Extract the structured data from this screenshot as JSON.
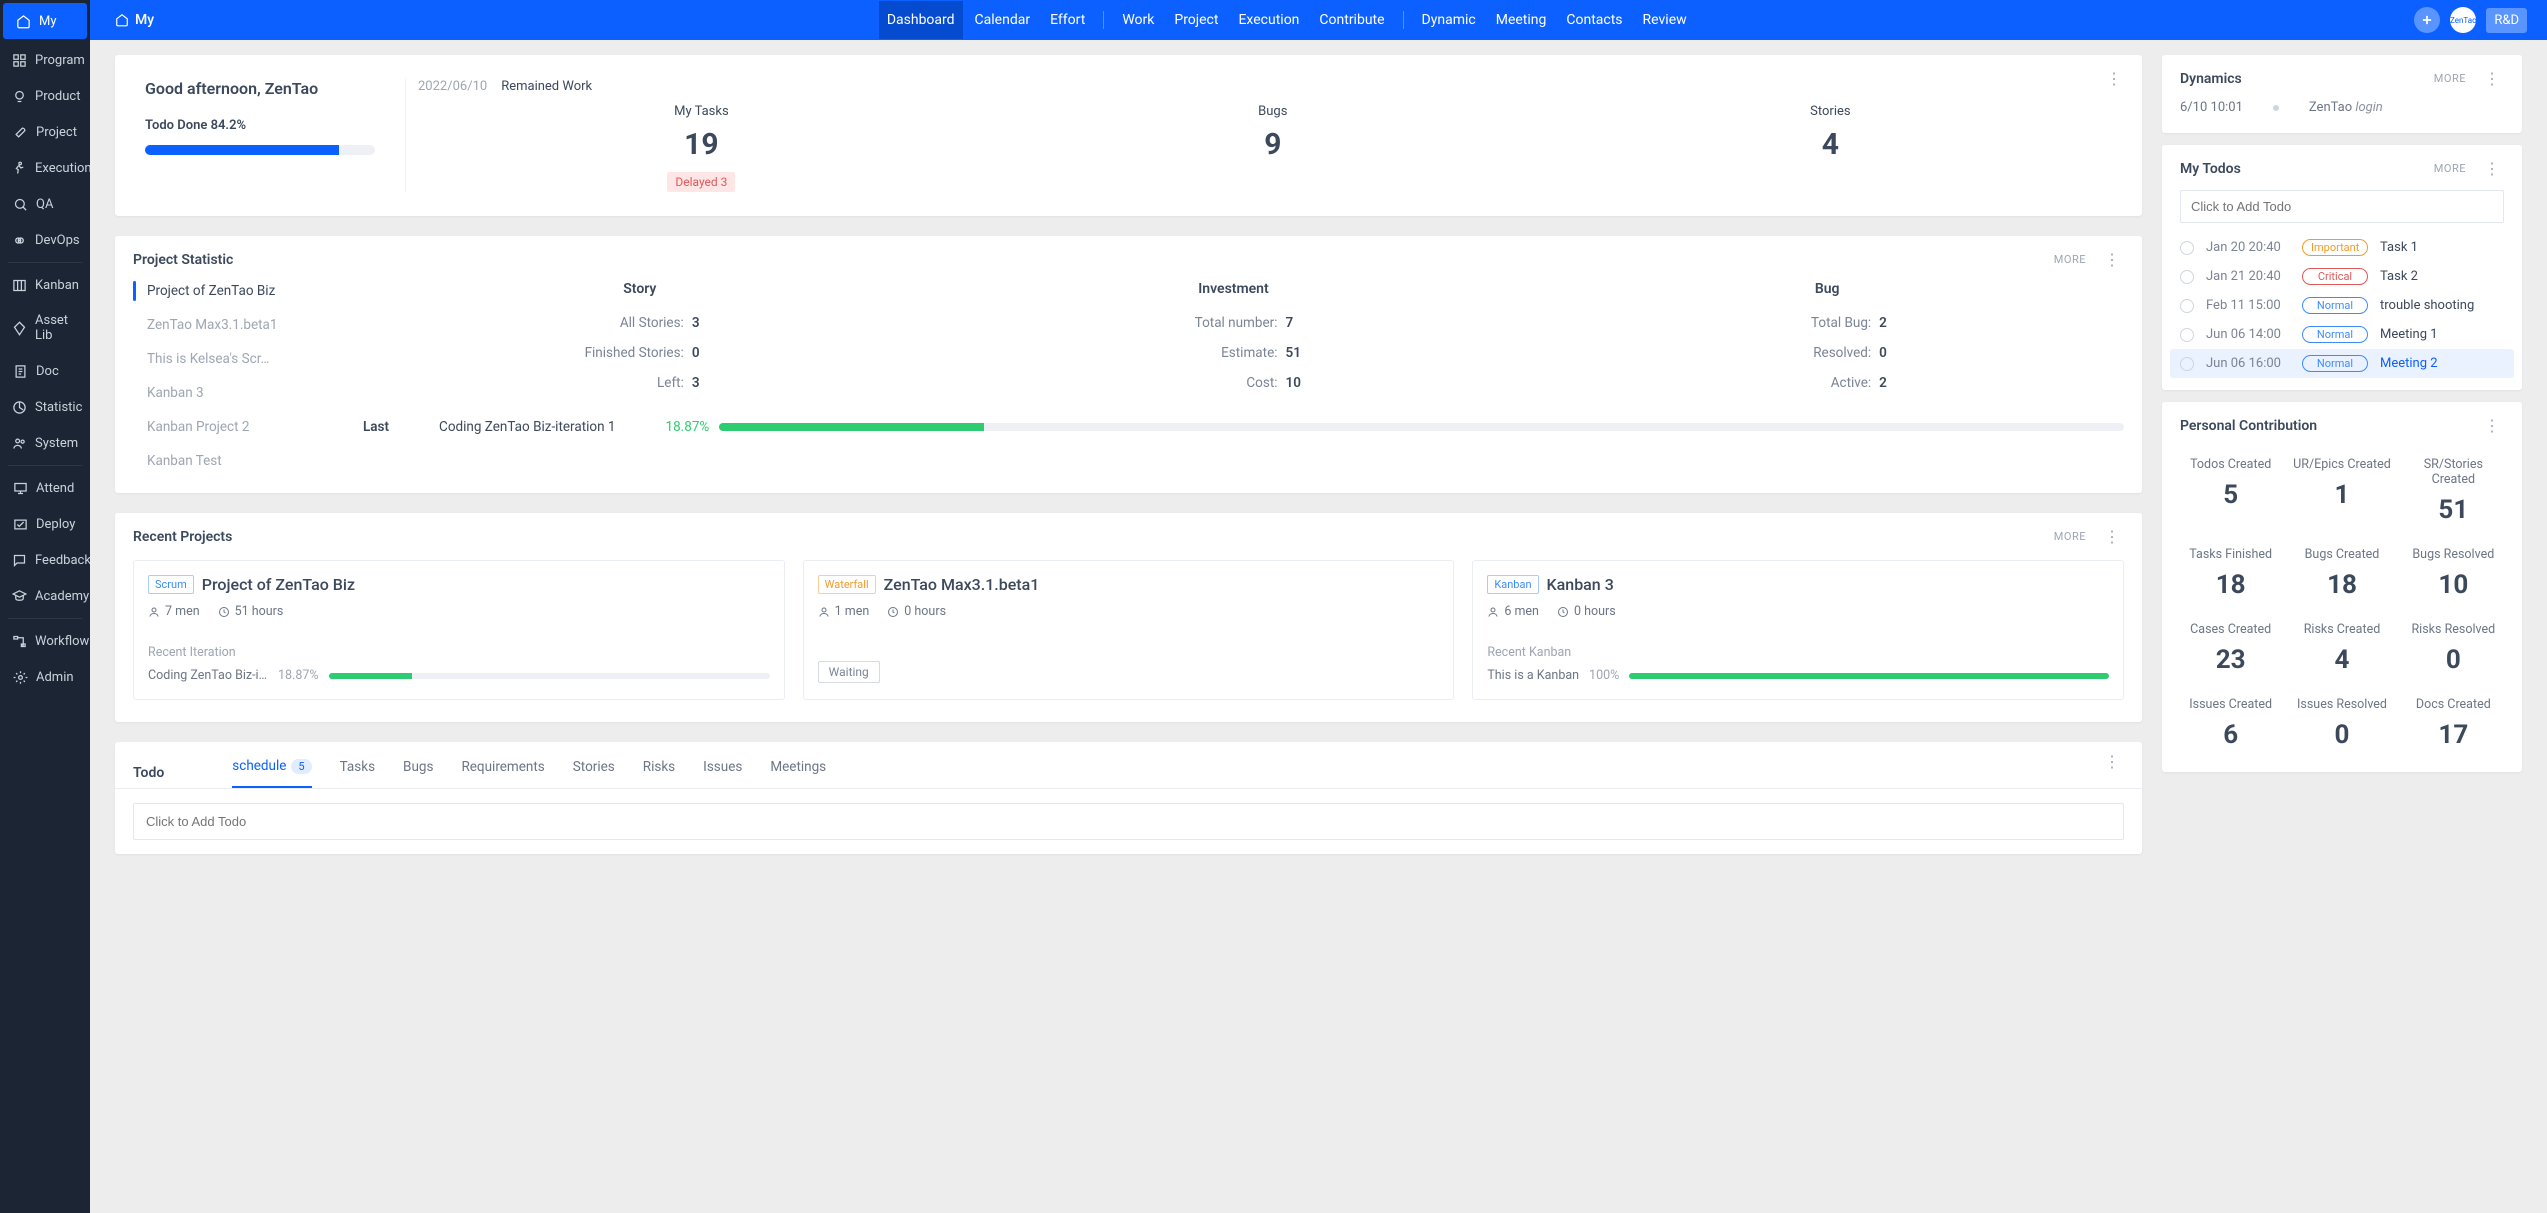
{
  "sidebar": {
    "items": [
      {
        "label": "My",
        "icon": "home"
      },
      {
        "label": "Program",
        "icon": "grid"
      },
      {
        "label": "Product",
        "icon": "bulb"
      },
      {
        "label": "Project",
        "icon": "rocket"
      },
      {
        "label": "Execution",
        "icon": "run"
      },
      {
        "label": "QA",
        "icon": "search"
      },
      {
        "label": "DevOps",
        "icon": "infinity"
      },
      {
        "label": "Kanban",
        "icon": "board"
      },
      {
        "label": "Asset Lib",
        "icon": "diamond"
      },
      {
        "label": "Doc",
        "icon": "doc"
      },
      {
        "label": "Statistic",
        "icon": "chart"
      },
      {
        "label": "System",
        "icon": "users"
      },
      {
        "label": "Attend",
        "icon": "monitor"
      },
      {
        "label": "Deploy",
        "icon": "deploy"
      },
      {
        "label": "Feedback",
        "icon": "feedback"
      },
      {
        "label": "Academy",
        "icon": "academy"
      },
      {
        "label": "Workflow",
        "icon": "flow"
      },
      {
        "label": "Admin",
        "icon": "gear"
      }
    ]
  },
  "topbar": {
    "breadcrumb": "My",
    "tabs_a": [
      "Dashboard",
      "Calendar",
      "Effort"
    ],
    "tabs_b": [
      "Work",
      "Project",
      "Execution",
      "Contribute"
    ],
    "tabs_c": [
      "Dynamic",
      "Meeting",
      "Contacts",
      "Review"
    ],
    "rd": "R&D",
    "logo": "ZenTao"
  },
  "welcome": {
    "greeting": "Good afternoon, ZenTao",
    "progress_label": "Todo Done 84.2%",
    "progress_pct": 84.2,
    "date": "2022/06/10",
    "subtitle": "Remained Work",
    "stats": [
      {
        "label": "My Tasks",
        "value": "19",
        "delayed": "Delayed 3"
      },
      {
        "label": "Bugs",
        "value": "9"
      },
      {
        "label": "Stories",
        "value": "4"
      }
    ]
  },
  "project_statistic": {
    "title": "Project Statistic",
    "more": "MORE",
    "projects": [
      "Project of ZenTao Biz",
      "ZenTao Max3.1.beta1",
      "This is Kelsea's Scr…",
      "Kanban 3",
      "Kanban Project 2",
      "Kanban Test"
    ],
    "cols": {
      "story": {
        "title": "Story",
        "rows": [
          {
            "k": "All Stories:",
            "v": "3"
          },
          {
            "k": "Finished Stories:",
            "v": "0"
          },
          {
            "k": "Left:",
            "v": "3"
          }
        ]
      },
      "investment": {
        "title": "Investment",
        "rows": [
          {
            "k": "Total number:",
            "v": "7"
          },
          {
            "k": "Estimate:",
            "v": "51"
          },
          {
            "k": "Cost:",
            "v": "10"
          }
        ]
      },
      "bug": {
        "title": "Bug",
        "rows": [
          {
            "k": "Total Bug:",
            "v": "2"
          },
          {
            "k": "Resolved:",
            "v": "0"
          },
          {
            "k": "Active:",
            "v": "2"
          }
        ]
      }
    },
    "last": {
      "label": "Last",
      "name": "Coding ZenTao Biz-iteration 1",
      "pct": "18.87%",
      "pct_num": 18.87
    }
  },
  "recent": {
    "title": "Recent Projects",
    "more": "MORE",
    "items": [
      {
        "type": "Scrum",
        "type_class": "tag-scrum",
        "name": "Project of ZenTao Biz",
        "men": "7 men",
        "hours": "51 hours",
        "sub": "Recent Iteration",
        "iter": "Coding ZenTao Biz-itera...",
        "pct": "18.87%",
        "pct_num": 18.87
      },
      {
        "type": "Waterfall",
        "type_class": "tag-waterfall",
        "name": "ZenTao Max3.1.beta1",
        "men": "1 men",
        "hours": "0 hours",
        "waiting": "Waiting"
      },
      {
        "type": "Kanban",
        "type_class": "tag-kanban",
        "name": "Kanban 3",
        "men": "6 men",
        "hours": "0 hours",
        "sub": "Recent Kanban",
        "iter": "This is a Kanban",
        "pct": "100%",
        "pct_num": 100
      }
    ]
  },
  "todo": {
    "title": "Todo",
    "tabs": [
      {
        "label": "schedule",
        "count": "5"
      },
      {
        "label": "Tasks"
      },
      {
        "label": "Bugs"
      },
      {
        "label": "Requirements"
      },
      {
        "label": "Stories"
      },
      {
        "label": "Risks"
      },
      {
        "label": "Issues"
      },
      {
        "label": "Meetings"
      }
    ],
    "placeholder": "Click to Add Todo"
  },
  "dynamics": {
    "title": "Dynamics",
    "more": "MORE",
    "row": {
      "time": "6/10 10:01",
      "who": "ZenTao",
      "action": "login"
    }
  },
  "mytodos": {
    "title": "My Todos",
    "more": "MORE",
    "placeholder": "Click to Add Todo",
    "rows": [
      {
        "date": "Jan 20 20:40",
        "priority": "Important",
        "pclass": "p-important",
        "text": "Task 1"
      },
      {
        "date": "Jan 21 20:40",
        "priority": "Critical",
        "pclass": "p-critical",
        "text": "Task 2"
      },
      {
        "date": "Feb 11 15:00",
        "priority": "Normal",
        "pclass": "p-normal",
        "text": "trouble shooting"
      },
      {
        "date": "Jun 06 14:00",
        "priority": "Normal",
        "pclass": "p-normal",
        "text": "Meeting 1"
      },
      {
        "date": "Jun 06 16:00",
        "priority": "Normal",
        "pclass": "p-normal",
        "text": "Meeting 2",
        "link": true,
        "highlight": true
      }
    ]
  },
  "contribution": {
    "title": "Personal Contribution",
    "items": [
      {
        "label": "Todos Created",
        "value": "5"
      },
      {
        "label": "UR/Epics Created",
        "value": "1"
      },
      {
        "label": "SR/Stories Created",
        "value": "51"
      },
      {
        "label": "Tasks Finished",
        "value": "18"
      },
      {
        "label": "Bugs Created",
        "value": "18"
      },
      {
        "label": "Bugs Resolved",
        "value": "10"
      },
      {
        "label": "Cases Created",
        "value": "23"
      },
      {
        "label": "Risks Created",
        "value": "4"
      },
      {
        "label": "Risks Resolved",
        "value": "0"
      },
      {
        "label": "Issues Created",
        "value": "6"
      },
      {
        "label": "Issues Resolved",
        "value": "0"
      },
      {
        "label": "Docs Created",
        "value": "17"
      }
    ]
  }
}
